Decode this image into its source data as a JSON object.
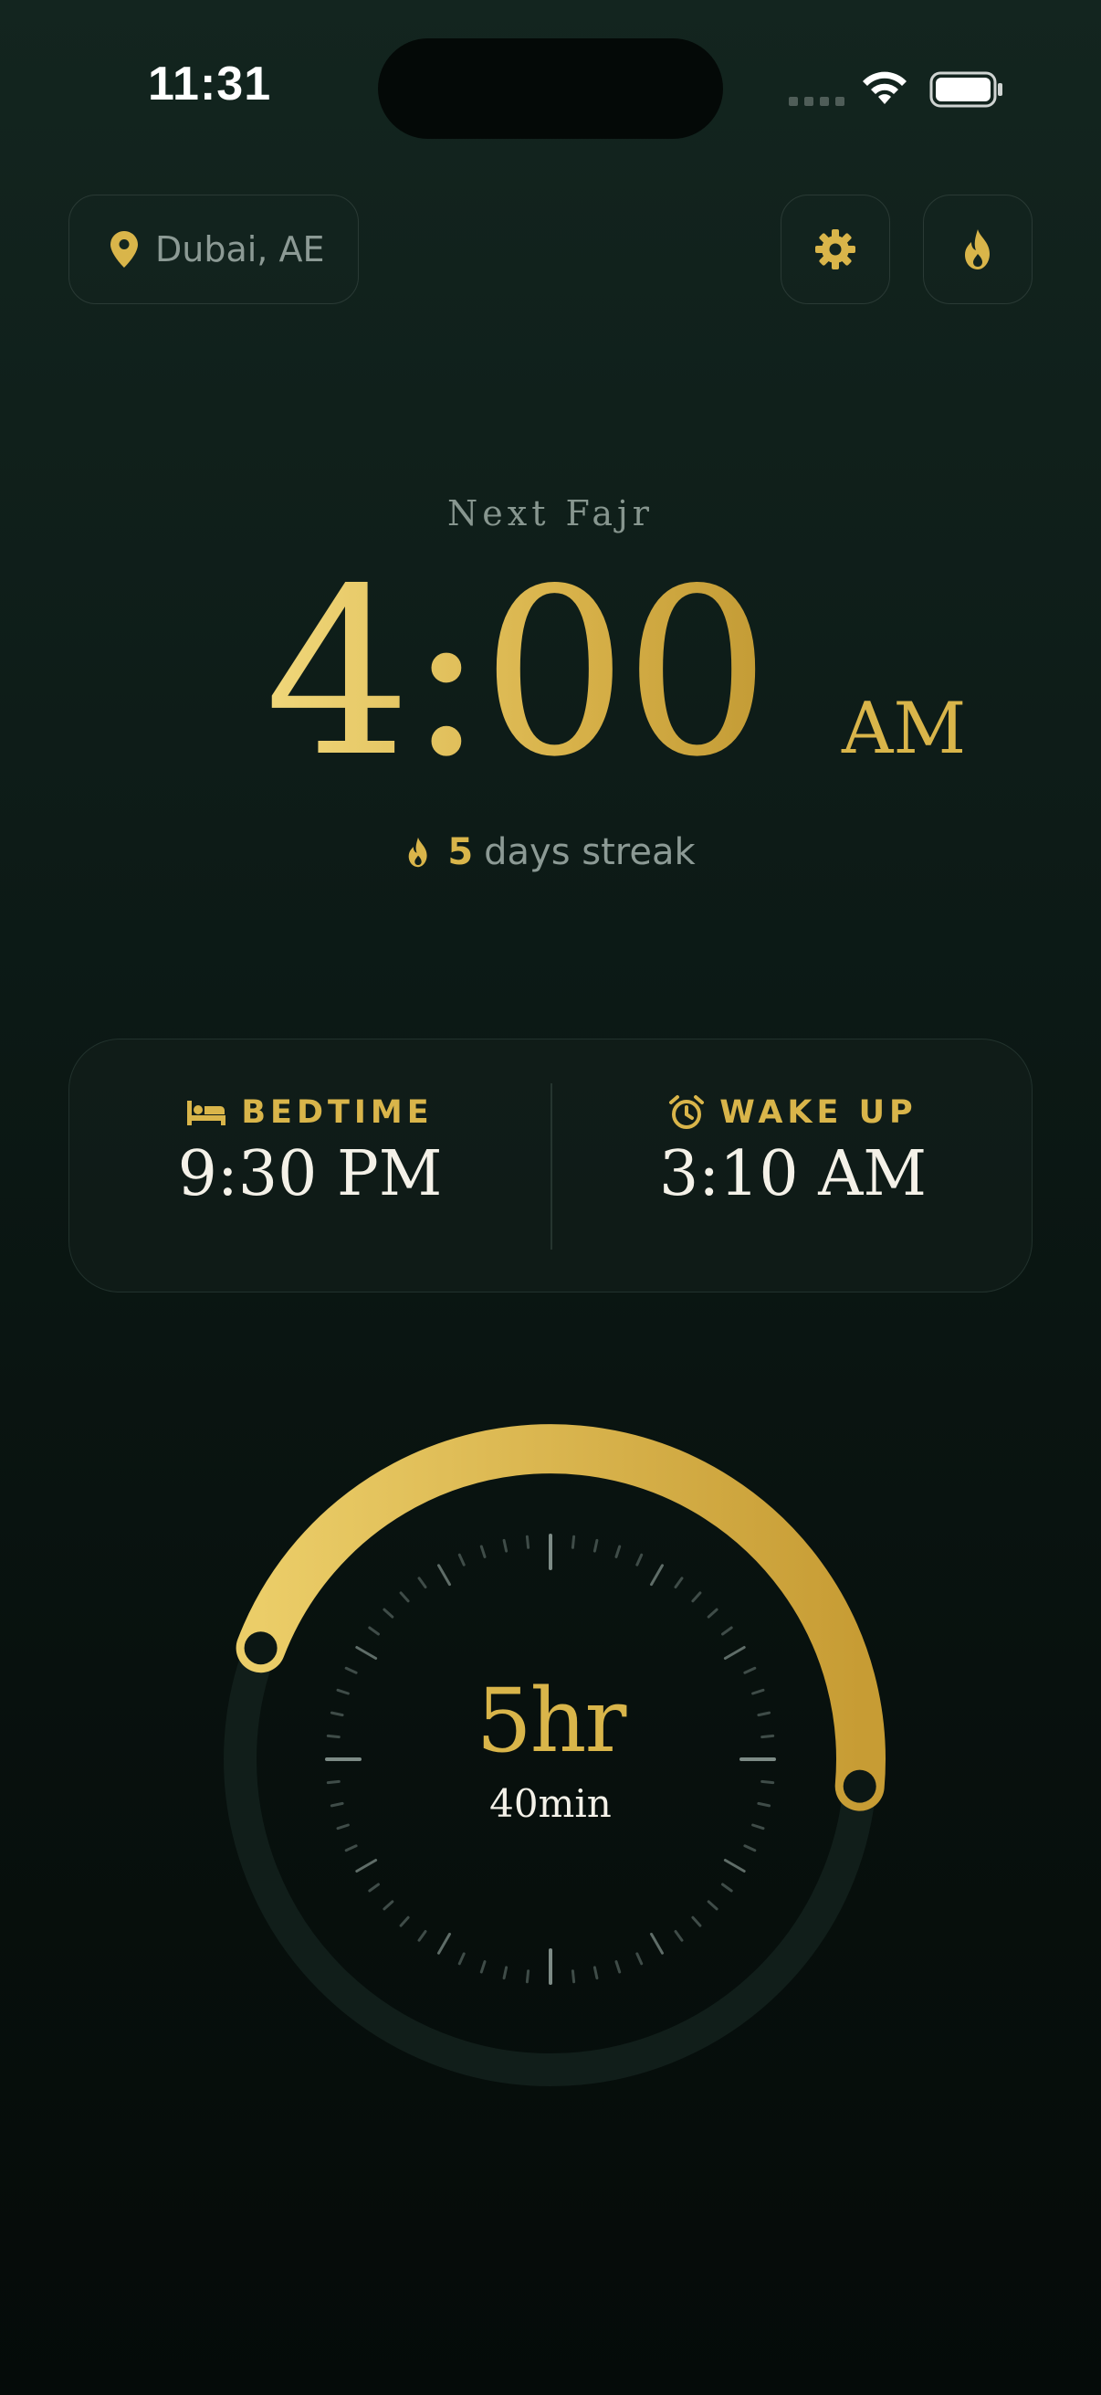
{
  "status_bar": {
    "time": "11:31",
    "icons": [
      "cellular-signal-icon",
      "wifi-icon",
      "battery-icon"
    ]
  },
  "header": {
    "location": "Dubai, AE",
    "location_icon": "map-pin-icon",
    "settings_icon": "gear-icon",
    "streak_icon": "flame-icon"
  },
  "next_prayer": {
    "label": "Next Fajr",
    "time": "4:00",
    "period": "AM"
  },
  "streak": {
    "count": "5",
    "text": "days streak"
  },
  "sleep": {
    "bedtime_label": "BEDTIME",
    "bedtime_value": "9:30 PM",
    "wakeup_label": "WAKE UP",
    "wakeup_value": "3:10 AM"
  },
  "duration": {
    "hours": "5hr",
    "minutes": "40min"
  },
  "colors": {
    "accent_gold": "#d9b54a",
    "background": "#0d1b17",
    "muted_text": "#8c9a95"
  }
}
